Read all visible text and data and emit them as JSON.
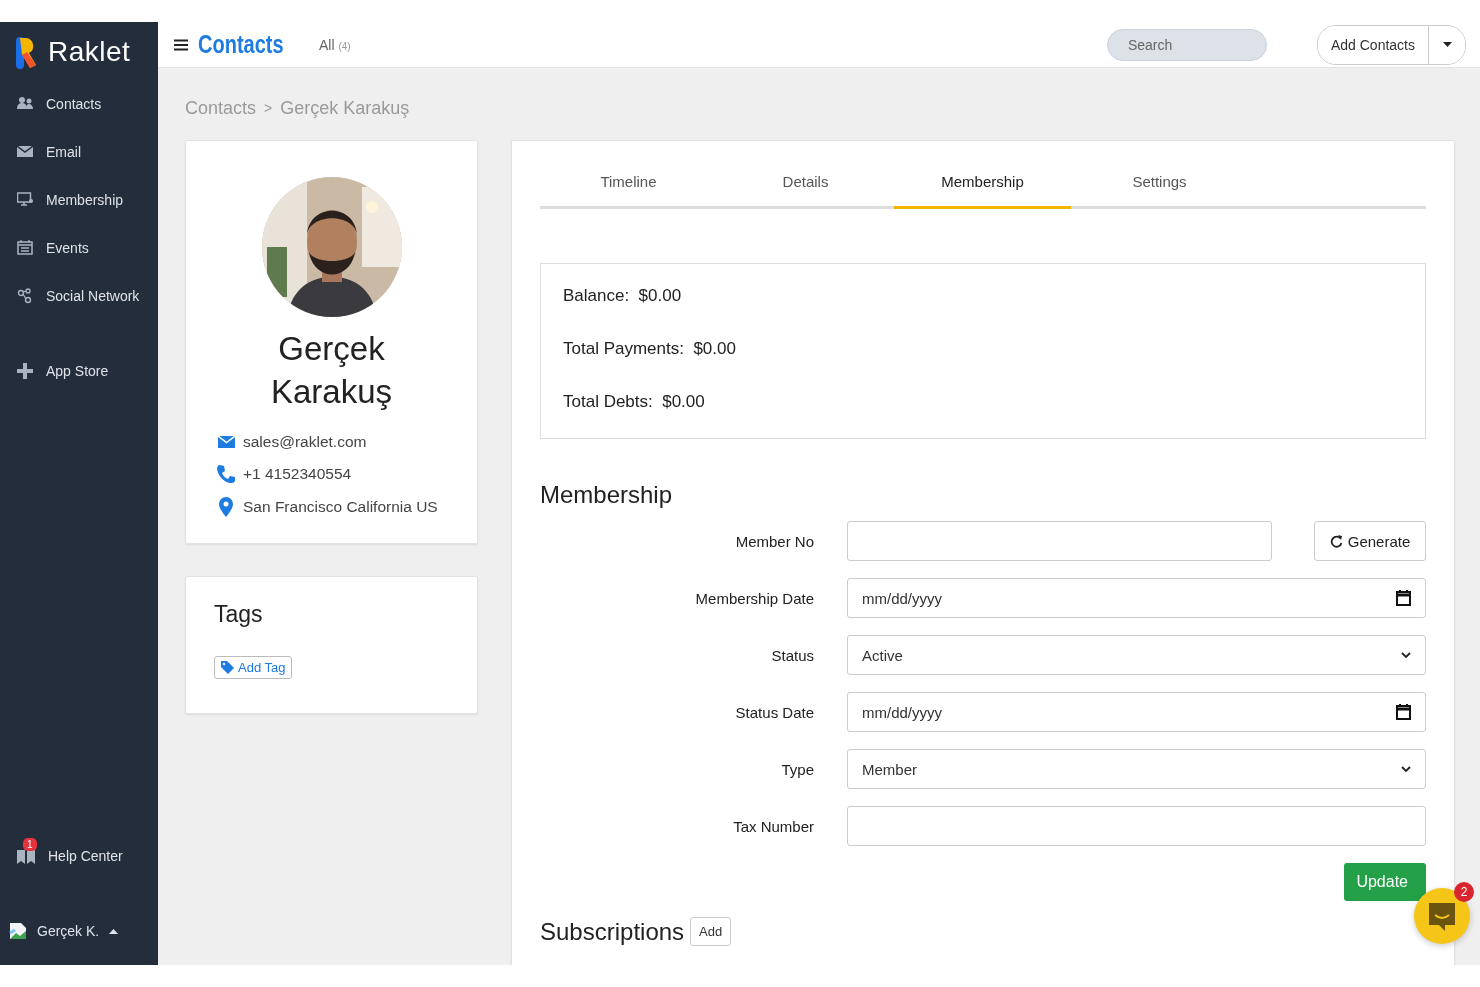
{
  "brand": {
    "name": "Raklet"
  },
  "sidebar": {
    "items": [
      {
        "label": "Contacts",
        "kind": "people"
      },
      {
        "label": "Email",
        "kind": "mail"
      },
      {
        "label": "Membership",
        "kind": "monitor"
      },
      {
        "label": "Events",
        "kind": "calendar"
      },
      {
        "label": "Social Network",
        "kind": "network"
      },
      {
        "label": "App Store",
        "kind": "plus"
      }
    ],
    "help": {
      "label": "Help Center",
      "badge": "1"
    },
    "user": {
      "name": "Gerçek K."
    }
  },
  "header": {
    "title": "Contacts",
    "filter": "All",
    "count": "(4)",
    "search_placeholder": "Search",
    "add_button": "Add Contacts"
  },
  "breadcrumb": {
    "items": [
      "Contacts",
      "Gerçek Karakuş"
    ],
    "separator": ">"
  },
  "profile": {
    "name": "Gerçek Karakuş",
    "details": [
      {
        "kind": "email",
        "text": "sales@raklet.com"
      },
      {
        "kind": "phone",
        "text": "+1 4152340554"
      },
      {
        "kind": "location",
        "text": "San Francisco California US"
      }
    ]
  },
  "tags": {
    "title": "Tags",
    "add_button": "Add Tag"
  },
  "tabs": [
    {
      "label": "Timeline",
      "selected": false
    },
    {
      "label": "Details",
      "selected": false
    },
    {
      "label": "Membership",
      "selected": true
    },
    {
      "label": "Settings",
      "selected": false
    }
  ],
  "balance": [
    {
      "label": "Balance:",
      "value": "$0.00"
    },
    {
      "label": "Total Payments:",
      "value": "$0.00"
    },
    {
      "label": "Total Debts:",
      "value": "$0.00"
    }
  ],
  "membership": {
    "title": "Membership",
    "fields": [
      {
        "label": "Member No",
        "kind": "text",
        "action": "Generate"
      },
      {
        "label": "Membership Date",
        "kind": "date",
        "placeholder": "mm/dd/yyyy"
      },
      {
        "label": "Status",
        "kind": "select",
        "value": "Active"
      },
      {
        "label": "Status Date",
        "kind": "date",
        "placeholder": "mm/dd/yyyy"
      },
      {
        "label": "Type",
        "kind": "select",
        "value": "Member"
      },
      {
        "label": "Tax Number",
        "kind": "text"
      }
    ],
    "update_button": "Update"
  },
  "subscriptions": {
    "title": "Subscriptions",
    "add_button": "Add"
  },
  "chat": {
    "badge": "2"
  }
}
